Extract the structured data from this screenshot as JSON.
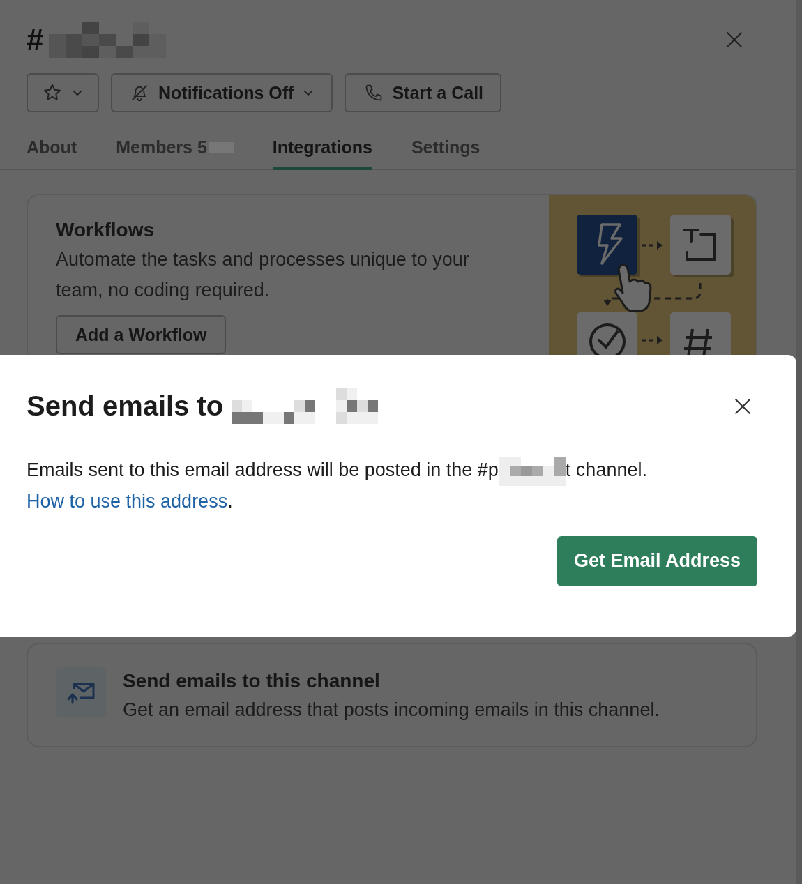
{
  "channel": {
    "prefix": "#"
  },
  "header_buttons": [
    {
      "kind": "star"
    },
    {
      "kind": "notifications",
      "label": "Notifications Off"
    },
    {
      "kind": "call",
      "label": "Start a Call"
    }
  ],
  "tabs": [
    {
      "label": "About",
      "selected": false
    },
    {
      "label": "Members 5",
      "selected": false
    },
    {
      "label": "Integrations",
      "selected": true
    },
    {
      "label": "Settings",
      "selected": false
    }
  ],
  "workflows_card": {
    "title": "Workflows",
    "description": "Automate the tasks and processes unique to your team, no coding required.",
    "button": "Add a Workflow"
  },
  "email_card": {
    "title": "Send emails to this channel",
    "description": "Get an email address that posts incoming emails in this channel."
  },
  "dialog": {
    "title": "Send emails to",
    "text_before": "Emails sent to this email address will be posted in the #p",
    "text_after": "t channel.",
    "link": "How to use this address",
    "link_suffix": ".",
    "button": "Get Email Address"
  }
}
